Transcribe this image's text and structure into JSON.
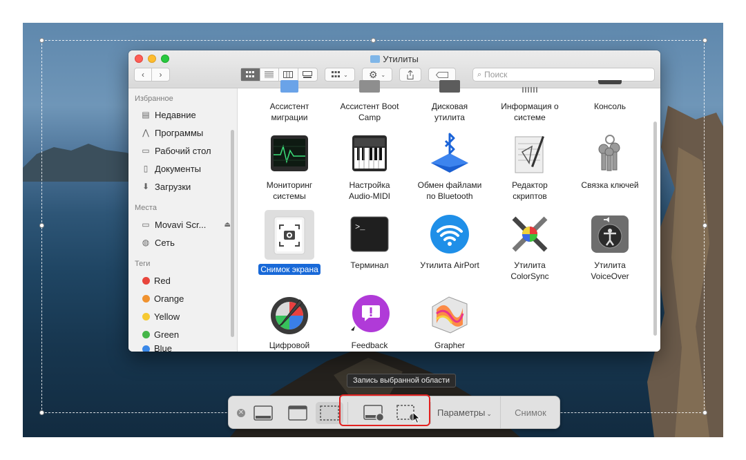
{
  "finder": {
    "title": "Утилиты",
    "search_placeholder": "Поиск",
    "sidebar": {
      "favorites_header": "Избранное",
      "favorites": [
        {
          "label": "Недавние",
          "icon": "recents-icon"
        },
        {
          "label": "Программы",
          "icon": "applications-icon"
        },
        {
          "label": "Рабочий стол",
          "icon": "desktop-icon"
        },
        {
          "label": "Документы",
          "icon": "documents-icon"
        },
        {
          "label": "Загрузки",
          "icon": "downloads-icon"
        }
      ],
      "places_header": "Места",
      "places": [
        {
          "label": "Movavi Scr...",
          "icon": "disk-icon"
        },
        {
          "label": "Сеть",
          "icon": "network-icon"
        }
      ],
      "tags_header": "Теги",
      "tags": [
        {
          "label": "Red",
          "color": "#e8453c"
        },
        {
          "label": "Orange",
          "color": "#f0922f"
        },
        {
          "label": "Yellow",
          "color": "#f6c932"
        },
        {
          "label": "Green",
          "color": "#45b649"
        },
        {
          "label": "Blue",
          "color": "#3a88e8"
        }
      ]
    },
    "apps": [
      {
        "label": "Ассистент\nмиграции",
        "icon": "migration-assistant-icon"
      },
      {
        "label": "Ассистент Boot\nCamp",
        "icon": "boot-camp-icon"
      },
      {
        "label": "Дисковая\nутилита",
        "icon": "disk-utility-icon"
      },
      {
        "label": "Информация о\nсистеме",
        "icon": "system-information-icon"
      },
      {
        "label": "Консоль",
        "icon": "console-icon"
      },
      {
        "label": "Мониторинг\nсистемы",
        "icon": "activity-monitor-icon"
      },
      {
        "label": "Настройка\nAudio-MIDI",
        "icon": "audio-midi-icon"
      },
      {
        "label": "Обмен файлами\nпо Bluetooth",
        "icon": "bluetooth-exchange-icon"
      },
      {
        "label": "Редактор\nскриптов",
        "icon": "script-editor-icon"
      },
      {
        "label": "Связка ключей",
        "icon": "keychain-icon"
      },
      {
        "label": "Снимок экрана",
        "icon": "screenshot-icon",
        "selected": true
      },
      {
        "label": "Терминал",
        "icon": "terminal-icon"
      },
      {
        "label": "Утилита AirPort",
        "icon": "airport-icon"
      },
      {
        "label": "Утилита\nColorSync",
        "icon": "colorsync-icon"
      },
      {
        "label": "Утилита\nVoiceOver",
        "icon": "voiceover-icon"
      },
      {
        "label": "Цифровой",
        "icon": "digital-color-meter-icon"
      },
      {
        "label": "Feedback",
        "icon": "feedback-icon"
      },
      {
        "label": "Grapher",
        "icon": "grapher-icon"
      }
    ]
  },
  "screenshot_toolbar": {
    "tooltip": "Запись выбранной области",
    "options_label": "Параметры",
    "capture_label": "Снимок"
  }
}
